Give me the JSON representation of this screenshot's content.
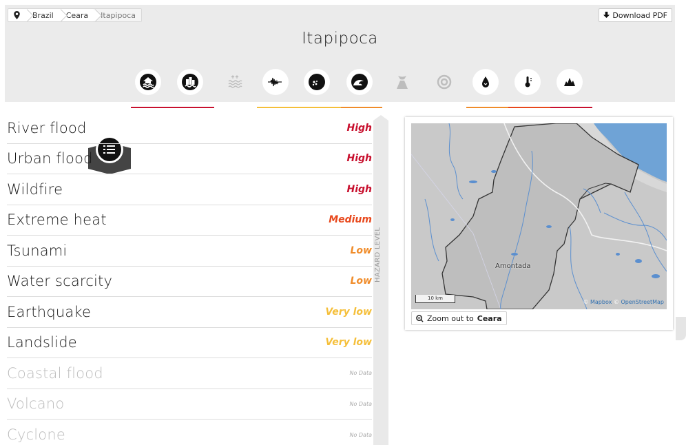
{
  "breadcrumb": [
    "Brazil",
    "Ceara",
    "Itapipoca"
  ],
  "download_label": "Download PDF",
  "title": "Itapipoca",
  "hazard_icons": [
    {
      "name": "list-icon",
      "active": true
    },
    {
      "name": "river-flood-icon",
      "active": true
    },
    {
      "name": "urban-flood-icon",
      "active": true
    },
    {
      "name": "coastal-flood-icon",
      "active": false
    },
    {
      "name": "earthquake-icon",
      "active": true
    },
    {
      "name": "landslide-icon",
      "active": true
    },
    {
      "name": "tsunami-icon",
      "active": true
    },
    {
      "name": "volcano-icon",
      "active": false
    },
    {
      "name": "cyclone-icon",
      "active": false
    },
    {
      "name": "water-scarcity-icon",
      "active": true
    },
    {
      "name": "extreme-heat-icon",
      "active": true
    },
    {
      "name": "wildfire-icon",
      "active": true
    }
  ],
  "hazards": [
    {
      "name": "River flood",
      "level": "High",
      "color": "#c8102e"
    },
    {
      "name": "Urban flood",
      "level": "High",
      "color": "#c8102e"
    },
    {
      "name": "Wildfire",
      "level": "High",
      "color": "#c8102e"
    },
    {
      "name": "Extreme heat",
      "level": "Medium",
      "color": "#e8481c"
    },
    {
      "name": "Tsunami",
      "level": "Low",
      "color": "#f08c2a"
    },
    {
      "name": "Water scarcity",
      "level": "Low",
      "color": "#f08c2a"
    },
    {
      "name": "Earthquake",
      "level": "Very low",
      "color": "#f5bf3a"
    },
    {
      "name": "Landslide",
      "level": "Very low",
      "color": "#f5bf3a"
    },
    {
      "name": "Coastal flood",
      "level": "No Data",
      "color": "#aaaaaa"
    },
    {
      "name": "Volcano",
      "level": "No Data",
      "color": "#aaaaaa"
    },
    {
      "name": "Cyclone",
      "level": "No Data",
      "color": "#aaaaaa"
    }
  ],
  "scale_label": "HAZARD LEVEL",
  "map": {
    "town": "Amontada",
    "scale": "10 km",
    "attribution_prefix": "© ",
    "attribution_mapbox": "Mapbox",
    "attribution_mid": " © ",
    "attribution_osm": "OpenStreetMap",
    "zoom_prefix": "Zoom out to ",
    "zoom_target": "Ceara"
  },
  "colors": {
    "high": "#c8102e",
    "medium": "#e8481c",
    "low": "#f08c2a",
    "very_low": "#f5bf3a",
    "sea": "#6fa3d6"
  }
}
